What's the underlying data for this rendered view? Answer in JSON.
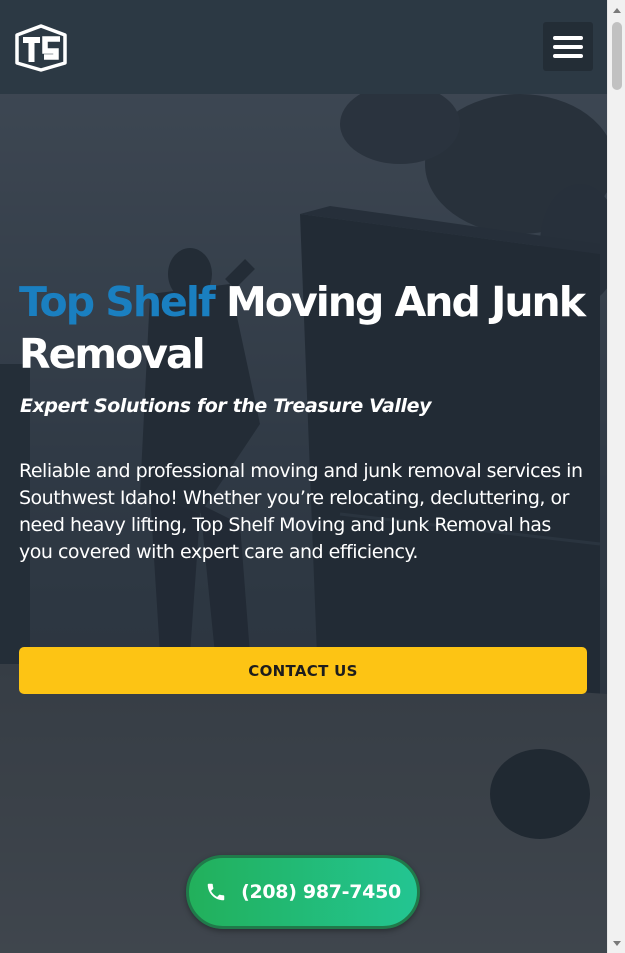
{
  "header": {
    "logo_text": "TS",
    "logo_icon": "top-shelf-logo",
    "menu_icon": "hamburger-menu-icon"
  },
  "hero": {
    "headline_brand": "Top Shelf",
    "headline_rest": " Moving And Junk Removal",
    "tagline": "Expert Solutions for the Treasure Valley",
    "intro": "Reliable and professional moving and junk removal services in Southwest Idaho! Whether you’re relocating, decluttering, or need heavy lifting, Top Shelf Moving and Junk Removal has you covered with expert care and efficiency.",
    "cta_label": "CONTACT US"
  },
  "call_button": {
    "icon": "phone-icon",
    "phone": "(208) 987-7450"
  },
  "colors": {
    "header_bg": "#2c3944",
    "brand_blue": "#1a7fc0",
    "cta_yellow": "#fdc414",
    "call_green": "#22b05b"
  }
}
